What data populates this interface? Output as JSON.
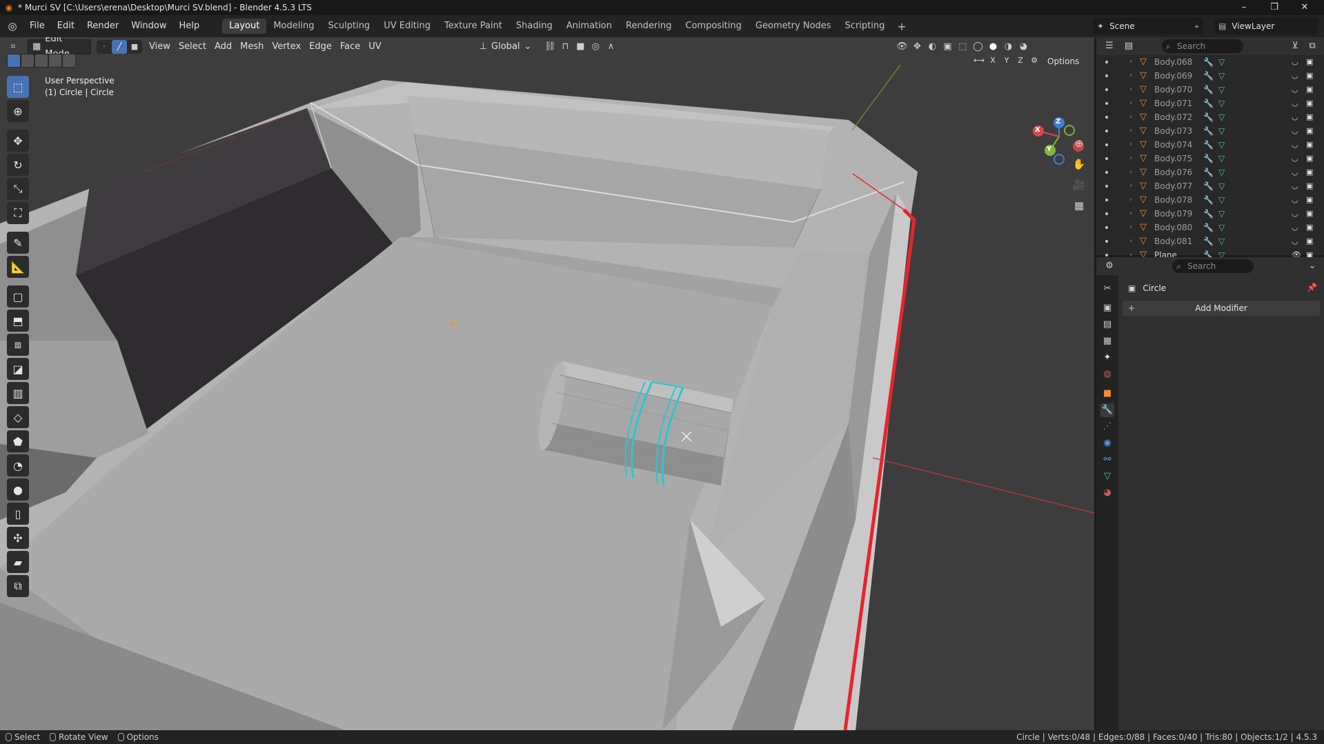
{
  "window": {
    "title": "* Murci SV [C:\\Users\\erena\\Desktop\\Murci SV.blend] - Blender 4.5.3 LTS",
    "minimize": "–",
    "maximize": "❐",
    "close": "✕"
  },
  "menu": [
    "File",
    "Edit",
    "Render",
    "Window",
    "Help"
  ],
  "workspaces": [
    "Layout",
    "Modeling",
    "Sculpting",
    "UV Editing",
    "Texture Paint",
    "Shading",
    "Animation",
    "Rendering",
    "Compositing",
    "Geometry Nodes",
    "Scripting"
  ],
  "active_workspace": "Layout",
  "scene": {
    "name": "Scene",
    "view_layer": "ViewLayer"
  },
  "viewport_header": {
    "mode": "Edit Mode",
    "menus": [
      "View",
      "Select",
      "Add",
      "Mesh",
      "Vertex",
      "Edge",
      "Face",
      "UV"
    ],
    "orientation": "Global",
    "options": "Options",
    "axes": [
      "X",
      "Y",
      "Z"
    ]
  },
  "viewport": {
    "view_name": "User Perspective",
    "object_info": "(1) Circle | Circle",
    "gizmo": {
      "x": "X",
      "y": "Y",
      "z": "Z"
    }
  },
  "outliner": {
    "search_placeholder": "Search",
    "items": [
      {
        "name": "Body.068",
        "dim": true
      },
      {
        "name": "Body.069",
        "dim": true
      },
      {
        "name": "Body.070",
        "dim": true
      },
      {
        "name": "Body.071",
        "dim": true
      },
      {
        "name": "Body.072",
        "dim": true
      },
      {
        "name": "Body.073",
        "dim": true
      },
      {
        "name": "Body.074",
        "dim": true
      },
      {
        "name": "Body.075",
        "dim": true
      },
      {
        "name": "Body.076",
        "dim": true
      },
      {
        "name": "Body.077",
        "dim": true
      },
      {
        "name": "Body.078",
        "dim": true
      },
      {
        "name": "Body.079",
        "dim": true
      },
      {
        "name": "Body.080",
        "dim": true
      },
      {
        "name": "Body.081",
        "dim": true
      },
      {
        "name": "Plane",
        "dim": false
      }
    ]
  },
  "properties": {
    "search_placeholder": "Search",
    "object_name": "Circle",
    "add_modifier": "Add Modifier"
  },
  "statusbar": {
    "select": "Select",
    "rotate": "Rotate View",
    "options": "Options",
    "stats": "Circle | Verts:0/48 | Edges:0/88 | Faces:0/40 | Tris:80 | Objects:1/2 | 4.5.3"
  },
  "colors": {
    "viewport_bg": "#3d3d3d",
    "panel_bg": "#282828",
    "accent": "#4772b3",
    "selection": "#29c7d6",
    "seam": "#e8242a"
  }
}
